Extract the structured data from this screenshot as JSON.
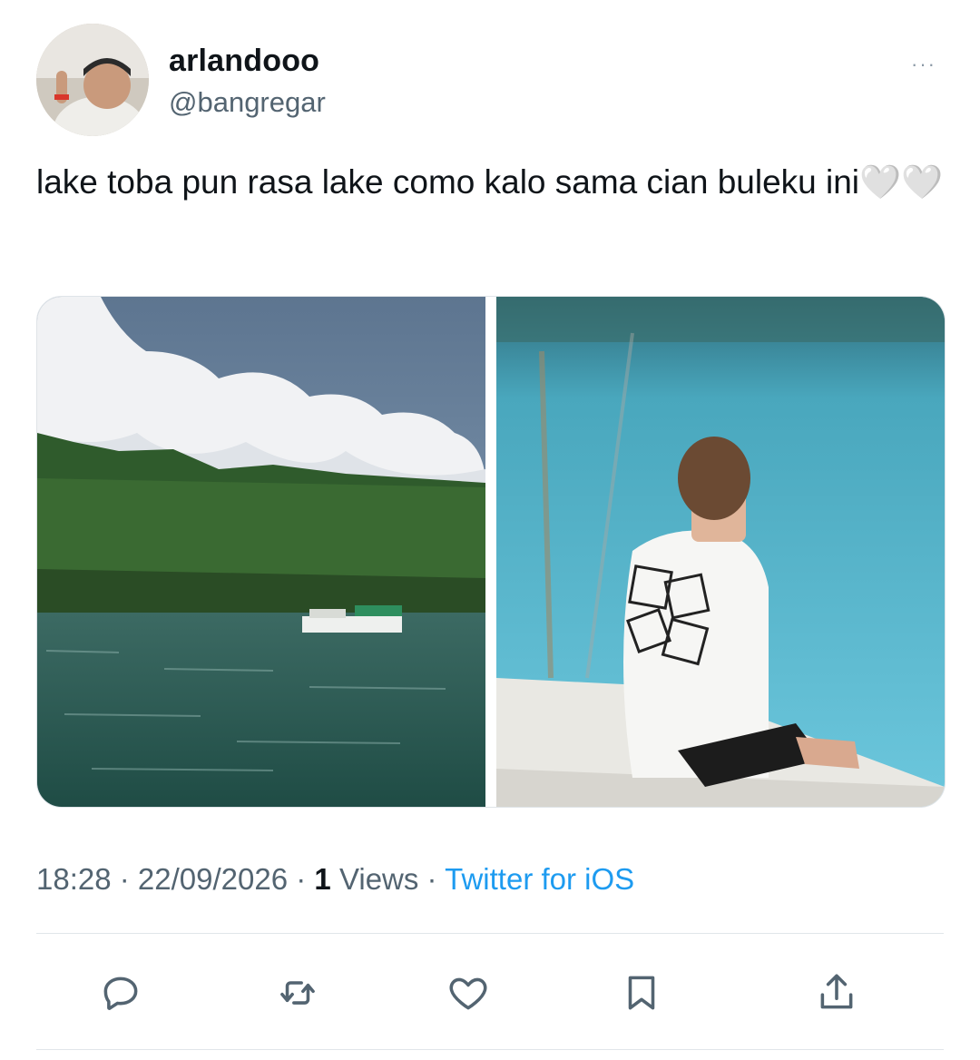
{
  "user": {
    "display_name": "arlandooo",
    "handle": "@bangregar"
  },
  "header": {
    "more_label": "···"
  },
  "tweet": {
    "text": "lake toba pun rasa lake como kalo sama cian buleku ini🤍🤍"
  },
  "media": [
    {
      "icon": "lake-landscape-photo"
    },
    {
      "icon": "person-by-water-photo"
    }
  ],
  "meta": {
    "time": "18:28",
    "sep1": " · ",
    "date": "22/09/2026",
    "sep2": " · ",
    "views_count": "1",
    "views_label": " Views",
    "sep3": " · ",
    "source": "Twitter for iOS"
  },
  "actions": [
    {
      "icon": "reply-icon"
    },
    {
      "icon": "retweet-icon"
    },
    {
      "icon": "like-icon"
    },
    {
      "icon": "bookmark-icon"
    },
    {
      "icon": "share-icon"
    }
  ],
  "colors": {
    "text": "#0f1419",
    "secondary": "#536471",
    "accent": "#1d9bf0"
  }
}
